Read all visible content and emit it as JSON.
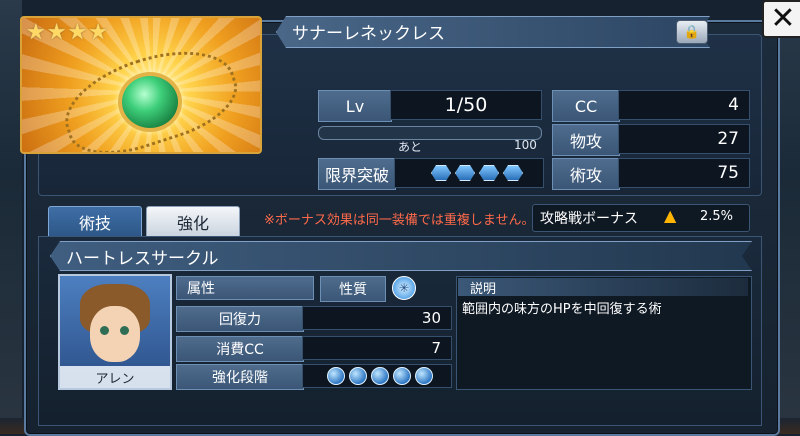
{
  "item": {
    "rarity": 4,
    "name": "サナーレネックレス",
    "lv_label": "Lv",
    "lv_value": "1/50",
    "exp_remaining_label": "あと",
    "exp_remaining_value": "100",
    "limit_break_label": "限界突破",
    "limit_break_slots": 4
  },
  "stats": [
    {
      "label": "CC",
      "value": "4"
    },
    {
      "label": "物攻",
      "value": "27"
    },
    {
      "label": "術攻",
      "value": "75"
    }
  ],
  "tabs": [
    {
      "label": "術技",
      "active": true
    },
    {
      "label": "強化",
      "active": false
    }
  ],
  "notice": "※ボーナス効果は同一装備では重複しません。",
  "bonus": {
    "label": "攻略戦ボーナス",
    "value": "2.5%"
  },
  "skill": {
    "name": "ハートレスサークル",
    "character": "アレン",
    "attribute_label": "属性",
    "nature_label": "性質",
    "heal_label": "回復力",
    "heal_value": "30",
    "cc_label": "消費CC",
    "cc_value": "7",
    "enhance_label": "強化段階",
    "enhance_slots": 5,
    "desc_label": "説明",
    "description": "範囲内の味方のHPを中回復する術"
  },
  "icons": {
    "close": "close-icon",
    "lock": "lock-icon",
    "up_arrow": "up-arrow-icon"
  }
}
